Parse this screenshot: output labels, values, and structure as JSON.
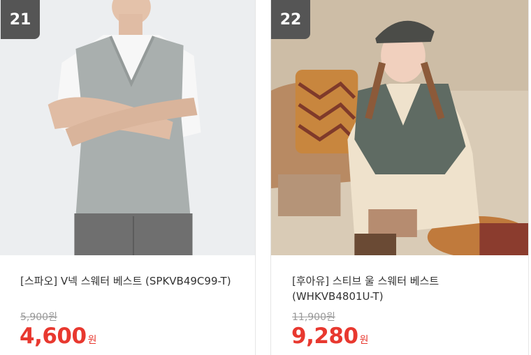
{
  "colors": {
    "accent_price": "#e8382f",
    "rank_badge": "#555555",
    "original_price": "#999999"
  },
  "products": [
    {
      "rank": "21",
      "title": "[스파오] V넥 스웨터 베스트 (SPKVB49C99-T)",
      "original_price": "5,900원",
      "price": "4,600",
      "currency": "원"
    },
    {
      "rank": "22",
      "title": "[후아유] 스티브 울 스웨터 베스트 (WHKVB4801U-T)",
      "original_price": "11,900원",
      "price": "9,280",
      "currency": "원"
    }
  ]
}
